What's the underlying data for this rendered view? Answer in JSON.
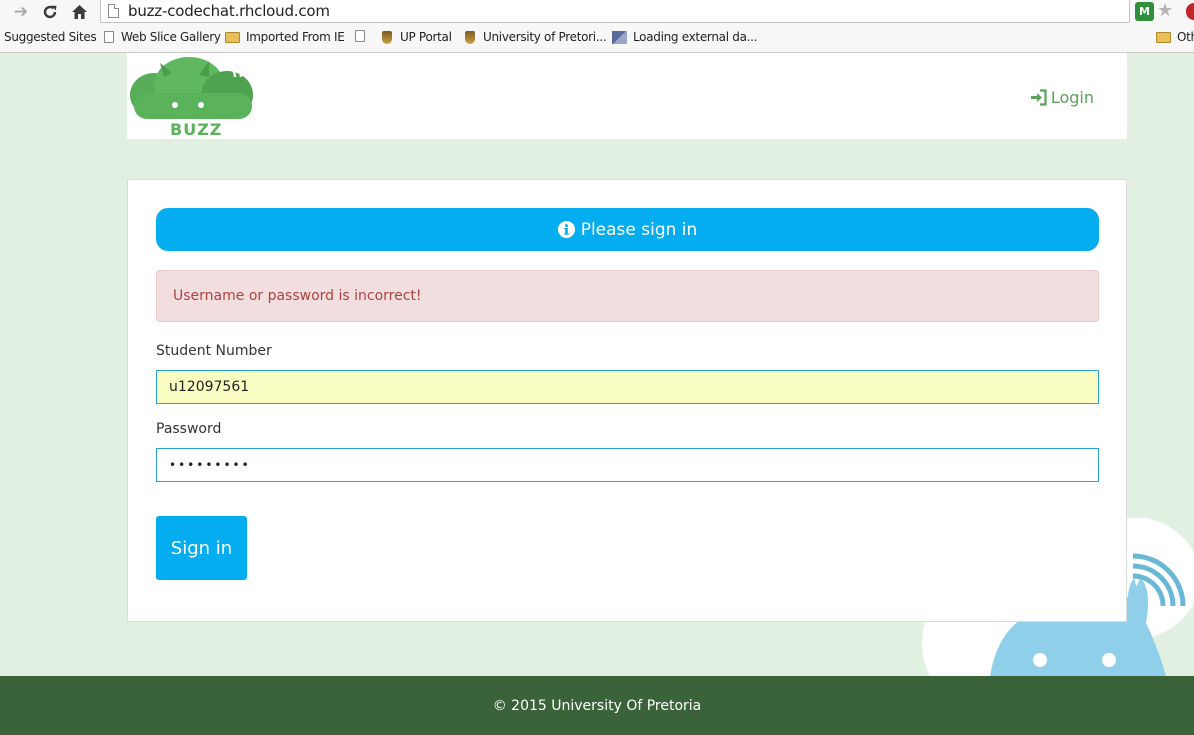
{
  "browser": {
    "url": "buzz-codechat.rhcloud.com",
    "ext_label": "M",
    "bookmarks": [
      {
        "label": "Suggested Sites"
      },
      {
        "label": "Web Slice Gallery"
      },
      {
        "label": "Imported From IE"
      },
      {
        "label": ""
      },
      {
        "label": "UP Portal"
      },
      {
        "label": "University of Pretori..."
      },
      {
        "label": "Loading external da..."
      },
      {
        "label": "Oth"
      }
    ]
  },
  "header": {
    "logo_text": "BUZZ",
    "login_label": "Login"
  },
  "form": {
    "banner": "Please sign in",
    "error": "Username or password is incorrect!",
    "student_number_label": "Student Number",
    "student_number_value": "u12097561",
    "password_label": "Password",
    "password_value": "•••••••••",
    "submit_label": "Sign in"
  },
  "footer": {
    "text": "© 2015 University Of Pretoria"
  },
  "colors": {
    "accent": "#03adef",
    "brand_green": "#5bb35b",
    "footer_bg": "#3a6339",
    "page_bg": "#e2f0e1",
    "error_text": "#a94442"
  }
}
